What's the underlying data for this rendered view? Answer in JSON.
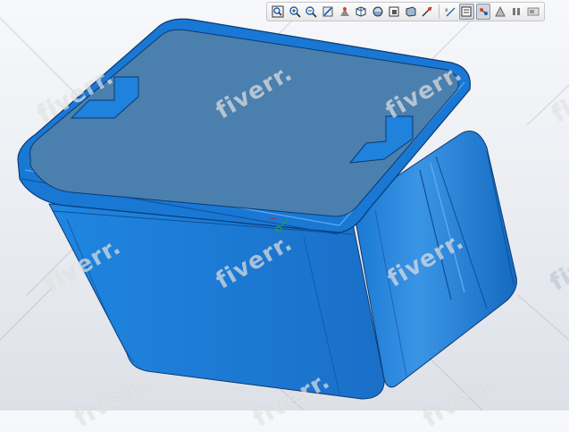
{
  "toolbar": {
    "buttons": [
      {
        "name": "zoom-fit-icon",
        "active": false
      },
      {
        "name": "zoom-in-icon",
        "active": false
      },
      {
        "name": "zoom-out-icon",
        "active": false
      },
      {
        "name": "repaint-icon",
        "active": false
      },
      {
        "name": "orient-icon",
        "active": false
      },
      {
        "name": "saved-views-icon",
        "active": false
      },
      {
        "name": "display-style-icon",
        "active": false
      },
      {
        "name": "view-manager-icon",
        "active": false
      },
      {
        "name": "perspective-icon",
        "active": false
      },
      {
        "name": "section-icon",
        "active": false
      },
      {
        "name": "datum-display-icon",
        "active": false
      },
      {
        "name": "annotation-display-icon",
        "active": true
      },
      {
        "name": "spin-center-icon",
        "active": true
      },
      {
        "name": "appearance-icon",
        "active": false
      },
      {
        "name": "pause-icon",
        "active": false
      },
      {
        "name": "graphics-settings-icon",
        "active": false
      }
    ]
  },
  "model": {
    "name": "storage-bin",
    "color_body": "#1a78d2",
    "color_lid": "#4a7fae",
    "color_edge": "#0a3a74"
  },
  "watermark": {
    "text": "fiverr."
  },
  "colors": {
    "background_top": "#f7f8fb",
    "background_bottom": "#dde1e7"
  }
}
